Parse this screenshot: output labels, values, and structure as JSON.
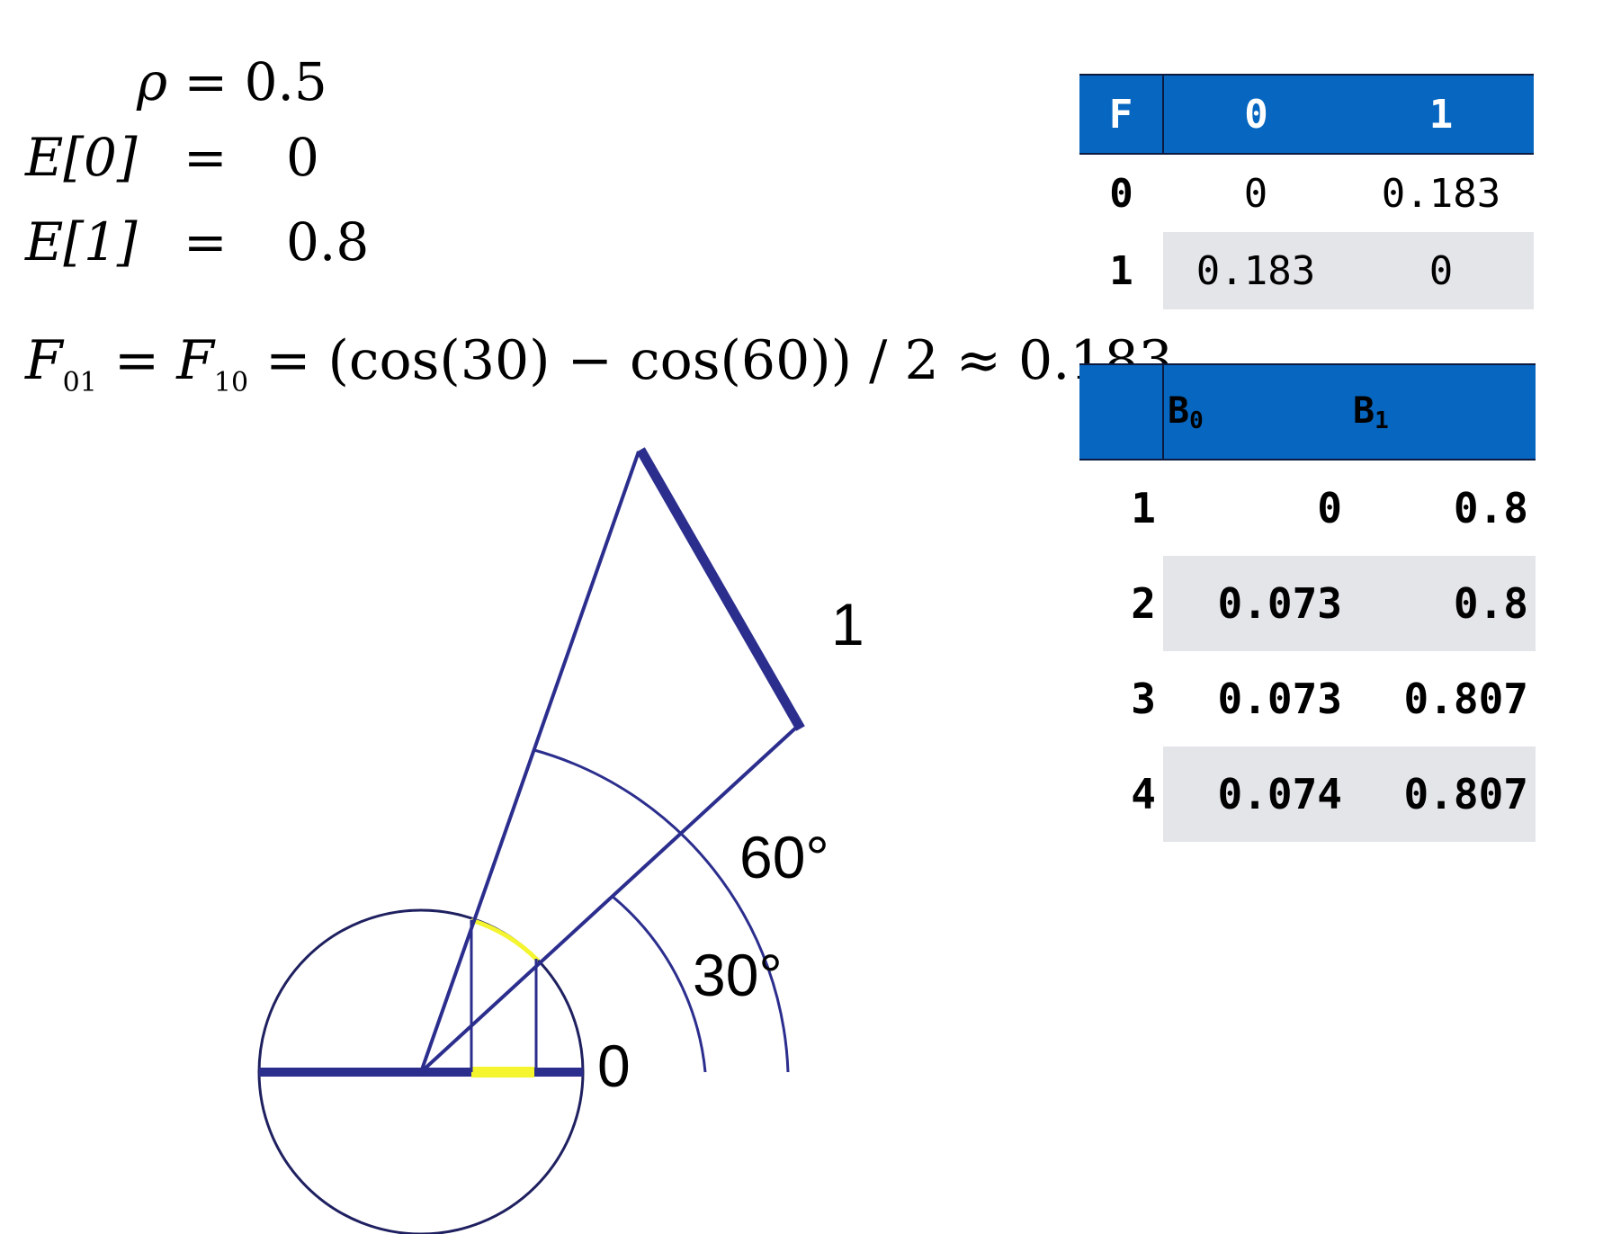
{
  "equations": {
    "rho": {
      "symbol": "ρ",
      "equals": "=",
      "value": "0.5"
    },
    "e0": {
      "lhs": "E[0]",
      "equals": "=",
      "value": "0"
    },
    "e1": {
      "lhs": "E[1]",
      "equals": "=",
      "value": "0.8"
    }
  },
  "formula": {
    "f": "F",
    "sub_01": "01",
    "sub_10": "10",
    "rest": " = (cos(30) − cos(60)) / 2 ≈ 0.183",
    "equals": " = "
  },
  "f_table": {
    "corner": "F",
    "columns": [
      "0",
      "1"
    ],
    "rows": [
      {
        "label": "0",
        "values": [
          "0",
          "0.183"
        ]
      },
      {
        "label": "1",
        "values": [
          "0.183",
          "0"
        ]
      }
    ]
  },
  "b_table": {
    "columns": [
      {
        "name": "B",
        "sub": "0"
      },
      {
        "name": "B",
        "sub": "1"
      }
    ],
    "rows": [
      {
        "label": "1",
        "values": [
          "0",
          "0.8"
        ]
      },
      {
        "label": "2",
        "values": [
          "0.073",
          "0.8"
        ]
      },
      {
        "label": "3",
        "values": [
          "0.073",
          "0.807"
        ]
      },
      {
        "label": "4",
        "values": [
          "0.074",
          "0.807"
        ]
      }
    ]
  },
  "diagram": {
    "label_patch_0": "0",
    "label_patch_1": "1",
    "label_angle_30": "30°",
    "label_angle_60": "60°",
    "colors": {
      "line": "#2c2e8e",
      "highlight": "#f4f52e",
      "circle": "#1f2060"
    }
  }
}
